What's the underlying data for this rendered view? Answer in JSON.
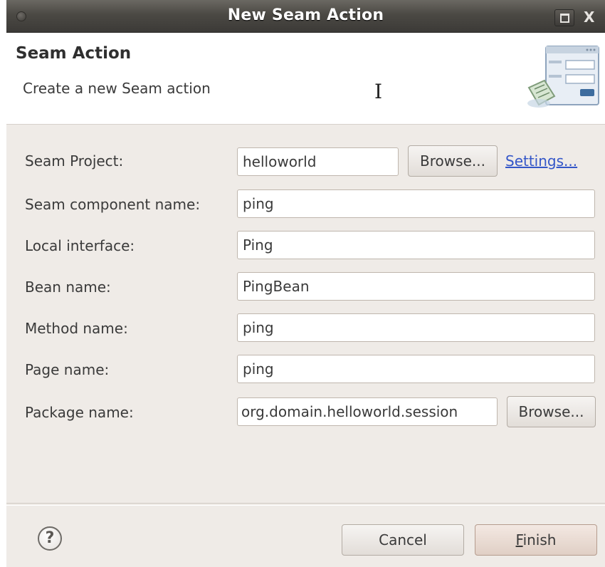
{
  "window": {
    "title": "New Seam Action",
    "close_glyph": "X"
  },
  "header": {
    "title": "Seam Action",
    "description": "Create a new Seam action",
    "cursor_glyph": "I"
  },
  "form": {
    "seam_project": {
      "label": "Seam Project:",
      "value": "helloworld",
      "browse_label": "Browse...",
      "settings_link": "Settings..."
    },
    "component_name": {
      "label": "Seam component name:",
      "value": "ping"
    },
    "local_interface": {
      "label": "Local interface:",
      "value": "Ping"
    },
    "bean_name": {
      "label": "Bean name:",
      "value": "PingBean"
    },
    "method_name": {
      "label": "Method name:",
      "value": "ping"
    },
    "page_name": {
      "label": "Page name:",
      "value": "ping"
    },
    "package_name": {
      "label": "Package name:",
      "value": "org.domain.helloworld.session",
      "browse_label": "Browse..."
    }
  },
  "footer": {
    "help_glyph": "?",
    "cancel_label": "Cancel",
    "finish_mnemonic": "F",
    "finish_rest": "inish"
  },
  "colors": {
    "titlebar": "#4b4944",
    "dialog_bg": "#efebe7",
    "link": "#3456c8"
  }
}
